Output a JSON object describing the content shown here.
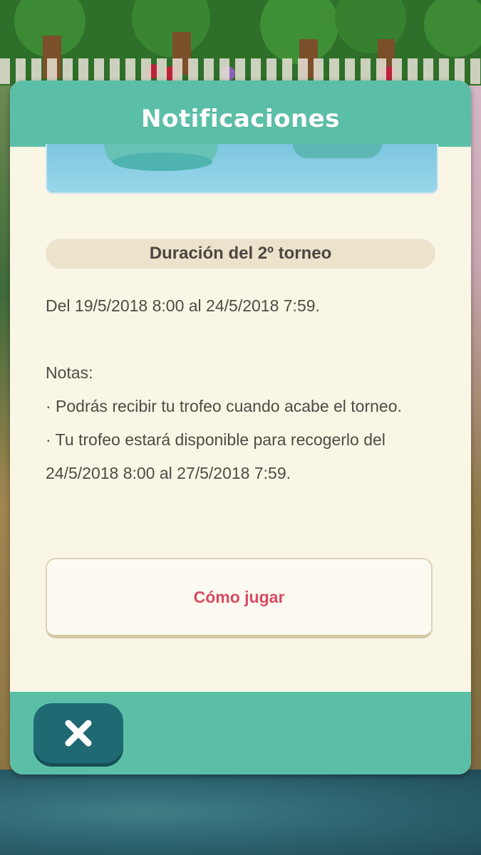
{
  "dialog": {
    "title": "Notificaciones"
  },
  "section": {
    "header": "Duración del 2º torneo"
  },
  "body": {
    "text": "Del 19/5/2018 8:00 al 24/5/2018 7:59.\n\nNotas:\n· Podrás recibir tu trofeo cuando acabe el torneo.\n· Tu trofeo estará disponible para recogerlo del 24/5/2018 8:00 al 27/5/2018 7:59."
  },
  "buttons": {
    "how_to_play": "Cómo jugar",
    "close_icon": "close-x-icon"
  },
  "colors": {
    "header_teal": "#5bbfa8",
    "panel_cream": "#faf6e6",
    "accent_pink": "#d94a64",
    "close_button": "#1f6a72"
  }
}
